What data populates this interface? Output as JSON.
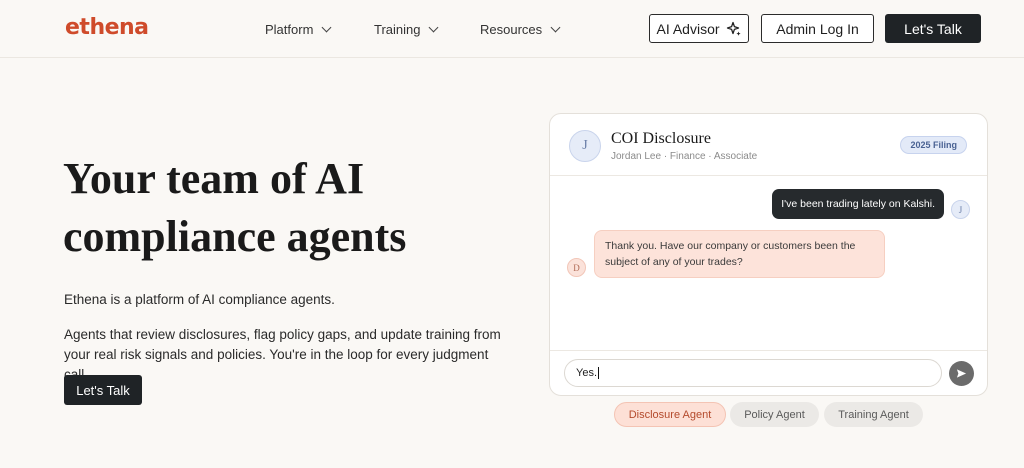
{
  "header": {
    "logo": "ethena",
    "nav": [
      {
        "label": "Platform"
      },
      {
        "label": "Training"
      },
      {
        "label": "Resources"
      }
    ],
    "ai_advisor_label": "AI Advisor",
    "admin_login_label": "Admin Log In",
    "cta_label": "Let's Talk"
  },
  "hero": {
    "title": "Your team of AI compliance agents",
    "intro": "Ethena is a platform of AI compliance agents.",
    "body": "Agents that review disclosures, flag policy gaps, and update training from your real risk signals and policies. You're in the loop for every judgment call.",
    "cta_label": "Let's Talk"
  },
  "chat": {
    "avatar_initial": "J",
    "title": "COI Disclosure",
    "subtitle": "Jordan Lee · Finance · Associate",
    "badge": "2025 Filing",
    "messages": [
      {
        "from": "user",
        "avatar": "J",
        "text": "I've been trading lately on Kalshi."
      },
      {
        "from": "agent",
        "avatar": "D",
        "text": "Thank you. Have our company or customers been the subject of any of your trades?"
      }
    ],
    "input_value": "Yes.",
    "send_icon": "send-icon"
  },
  "agents": [
    {
      "label": "Disclosure Agent",
      "active": true
    },
    {
      "label": "Policy Agent",
      "active": false
    },
    {
      "label": "Training Agent",
      "active": false
    }
  ],
  "colors": {
    "brand": "#cf4b2b",
    "dark_button": "#1f2326",
    "agent_bubble": "#fde3da",
    "badge_blue": "#e3eaf8"
  }
}
